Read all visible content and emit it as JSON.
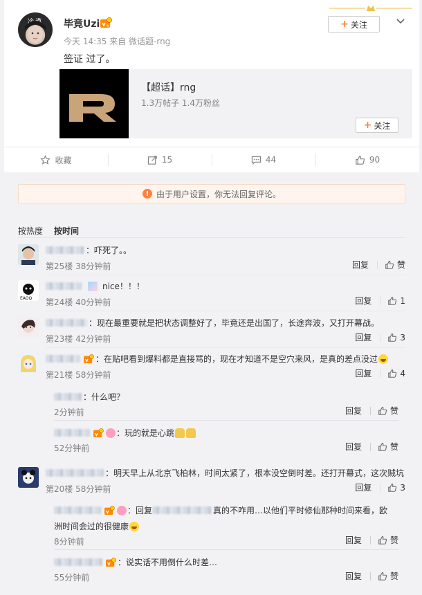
{
  "post": {
    "username": "毕竟Uzi",
    "avatar_text": "冷漠",
    "meta": "今天 14:35 来自 微话题-rng",
    "text": "签证 过了。",
    "follow_label": "关注",
    "topic": {
      "name": "【超话】rng",
      "stats": "1.3万帖子 1.4万粉丝",
      "follow_label": "关注"
    }
  },
  "actions": {
    "favorite": "收藏",
    "repost": "15",
    "comment": "44",
    "like": "90"
  },
  "notice": "由于用户设置，你无法回复评论。",
  "sort": {
    "hot": "按热度",
    "time": "按时间"
  },
  "reply_label": "回复",
  "like_label": "赞",
  "comments": [
    {
      "text": "：吓死了。。",
      "floor": "第25楼 38分钟前",
      "likes": "赞"
    },
    {
      "text": "：nice！！！",
      "floor": "第24楼 40分钟前",
      "likes": "1"
    },
    {
      "text": "：现在最重要就是把状态调整好了，毕竟还是出国了，长途奔波，又打开幕战。",
      "floor": "第23楼 42分钟前",
      "likes": "3"
    },
    {
      "text": "：在贴吧看到爆料都是直接骂的，现在才知道不是空穴来风，是真的差点没过",
      "floor": "第21楼 58分钟前",
      "likes": "4"
    },
    {
      "text": "：明天早上从北京飞柏林，时间太紧了，根本没空倒时差。还打开幕式，这次贼坑",
      "floor": "第20楼 58分钟前",
      "likes": "3"
    }
  ],
  "subs_21": [
    {
      "text": "：什么吧？",
      "time": "2分钟前",
      "likes": "赞"
    },
    {
      "text": "：玩的就是心跳",
      "time": "52分钟前",
      "likes": "赞"
    }
  ],
  "subs_20": [
    {
      "text_a": "：回复",
      "text_b": "真的不咋用…以他们平时修仙那种时间来看，欧",
      "text_c": "洲时间会过的很健康",
      "time": "8分钟前",
      "likes": "赞"
    },
    {
      "text": "：说实话不用倒什么时差…",
      "time": "55分钟前",
      "likes": "赞"
    }
  ],
  "colors": {
    "accent": "#ff8140",
    "bg": "#f2f2f5"
  }
}
